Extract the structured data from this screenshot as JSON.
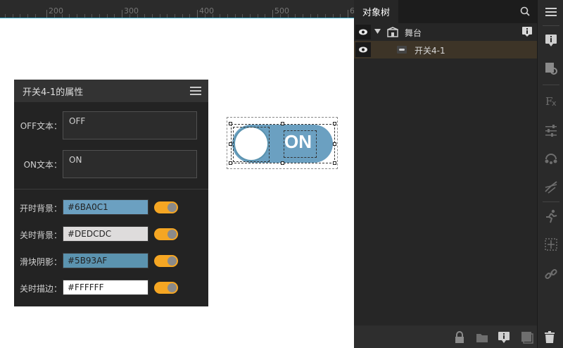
{
  "ruler": {
    "labels": [
      "200",
      "300",
      "400",
      "500",
      "60"
    ]
  },
  "properties_panel": {
    "title": "开关4-1的属性",
    "off_text_label": "OFF文本：",
    "off_text_value": "OFF",
    "on_text_label": "ON文本：",
    "on_text_value": "ON",
    "colors": [
      {
        "label": "开时背景：",
        "value": "#6BA0C1",
        "enabled": true
      },
      {
        "label": "关时背景：",
        "value": "#DEDCDC",
        "enabled": true
      },
      {
        "label": "滑块阴影：",
        "value": "#5B93AF",
        "enabled": true
      },
      {
        "label": "关时描边：",
        "value": "#FFFFFF",
        "enabled": true
      }
    ]
  },
  "canvas_switch": {
    "text": "ON",
    "on_color": "#6BA0C1",
    "shadow_color": "#5B93AF"
  },
  "object_tree": {
    "tab_label": "对象树",
    "nodes": [
      {
        "label": "舞台",
        "expanded": true
      },
      {
        "label": "开关4-1",
        "selected": true
      }
    ]
  },
  "icons": {
    "ruler": "ruler",
    "panel_menu": "hamburger-icon",
    "search": "search-icon",
    "right_toolbar": [
      "properties-icon",
      "component-settings-icon",
      "fx-icon",
      "sliders-icon",
      "interaction-icon",
      "path-icon",
      "animation-runner-icon",
      "bounds-icon",
      "link-icon"
    ],
    "bottom_bar": [
      "lock-icon",
      "folder-icon",
      "info-icon",
      "layers-icon",
      "trash-icon"
    ]
  }
}
